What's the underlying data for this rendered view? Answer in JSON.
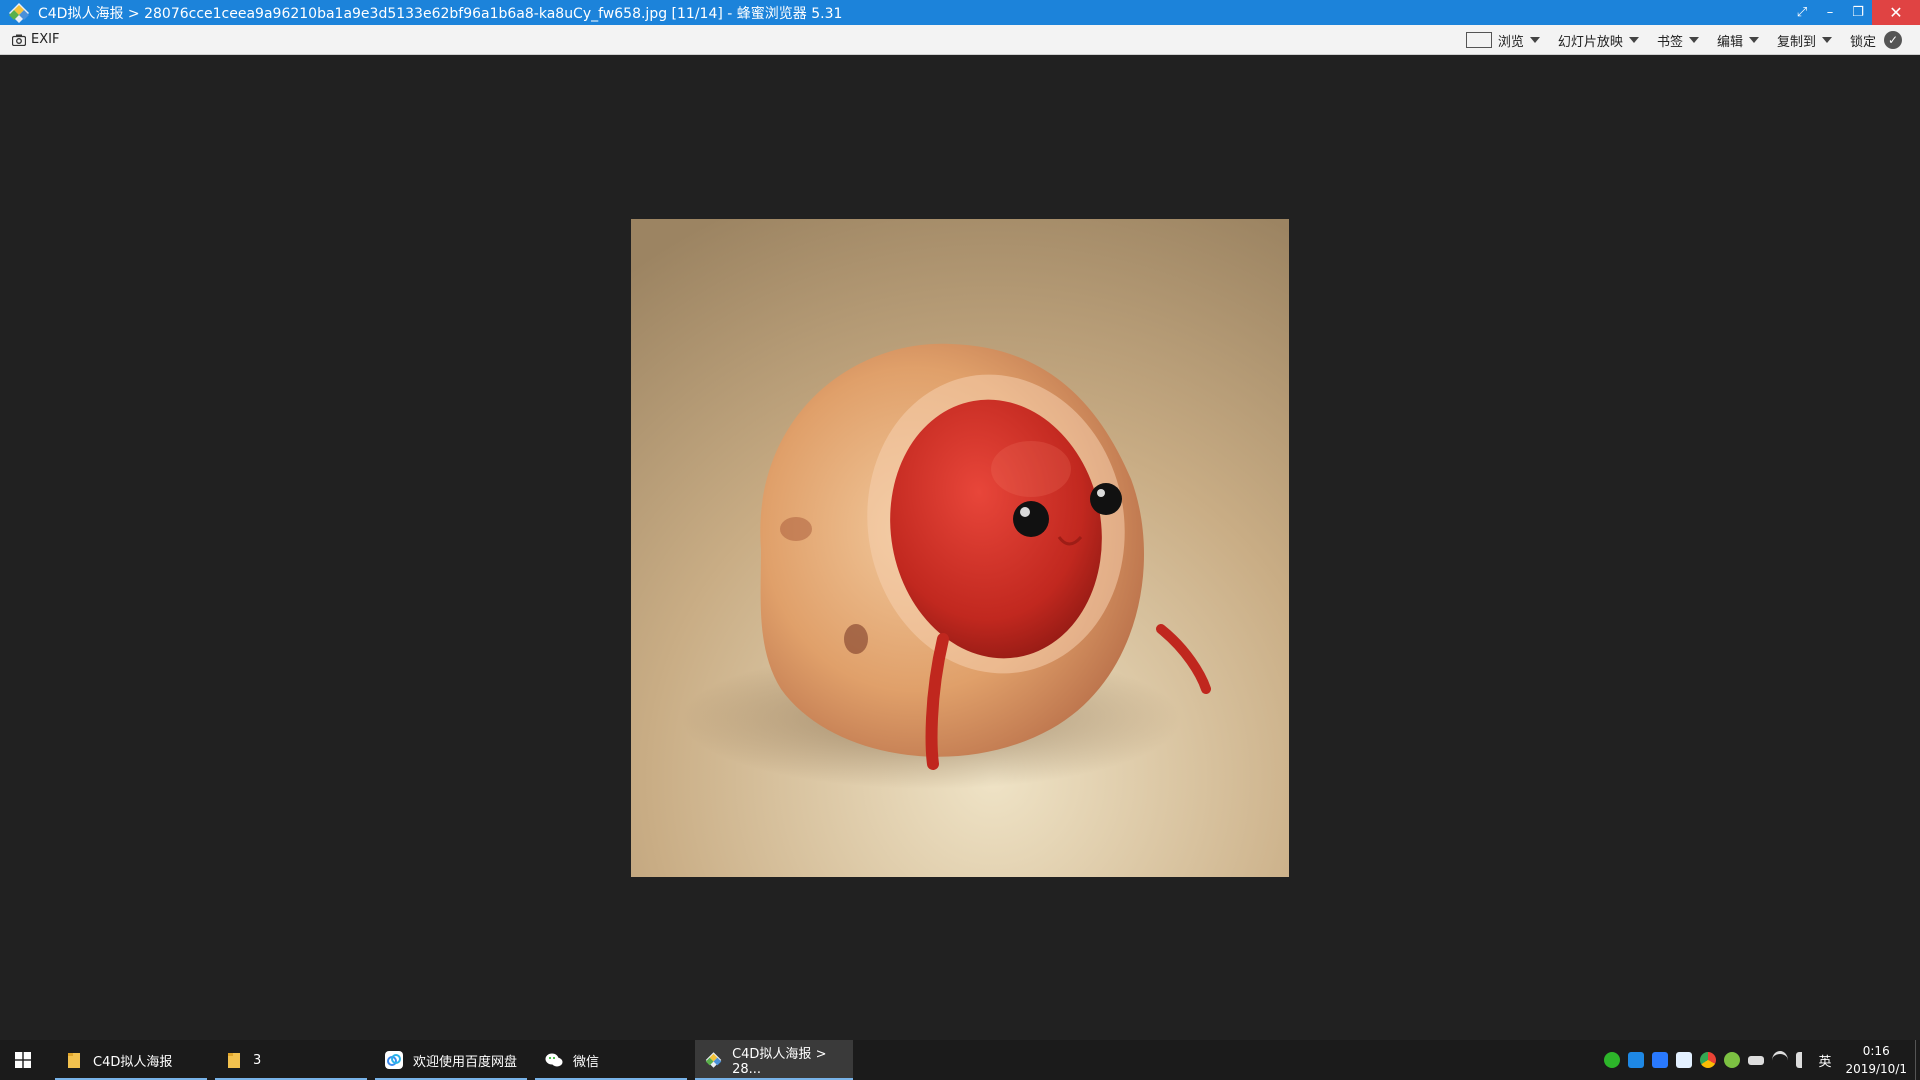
{
  "titlebar": {
    "title": "C4D拟人海报 > 28076cce1ceea9a96210ba1a9e3d5133e62bf96a1b6a8-ka8uCy_fw658.jpg [11/14] - 蜂蜜浏览器 5.31",
    "controls": [
      "⤢",
      "–",
      "❐",
      "✕"
    ]
  },
  "toolbar": {
    "exif_label": "EXIF",
    "items": [
      {
        "label": "浏览"
      },
      {
        "label": "幻灯片放映"
      },
      {
        "label": "书签"
      },
      {
        "label": "编辑"
      },
      {
        "label": "复制到"
      }
    ],
    "lock_label": "锁定"
  },
  "viewer": {
    "image": "red bean character on potato-like body, beige background"
  },
  "taskbar": {
    "tasks": [
      {
        "label": "C4D拟人海报",
        "icon": "folder-icon"
      },
      {
        "label": "3",
        "icon": "folder-icon"
      },
      {
        "label": "欢迎使用百度网盘",
        "icon": "baidu-netdisk-icon"
      },
      {
        "label": "微信",
        "icon": "wechat-icon"
      },
      {
        "label": "C4D拟人海报 > 28...",
        "icon": "honey-viewer-icon"
      }
    ],
    "ime": "英",
    "time": "0:16",
    "date": "2019/10/1"
  },
  "colors": {
    "titlebar": "#1c83da",
    "viewer_bg": "#212121",
    "taskbar": "#1b1b1b",
    "accent_underline": "#78b3e8"
  }
}
